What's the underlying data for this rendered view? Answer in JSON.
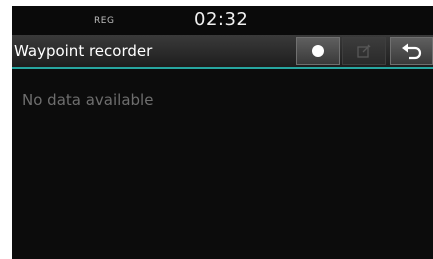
{
  "status_bar": {
    "reg_label": "REG",
    "time": "02:32"
  },
  "header": {
    "title": "Waypoint recorder"
  },
  "toolbar": {
    "record_icon": "record-dot-icon",
    "edit_icon": "edit-icon",
    "back_icon": "back-arrow-icon",
    "edit_enabled": false
  },
  "main": {
    "empty_message": "No data available"
  },
  "colors": {
    "accent": "#27a6a0",
    "background": "#0c0c0c",
    "muted_text": "#6e6e6e"
  }
}
